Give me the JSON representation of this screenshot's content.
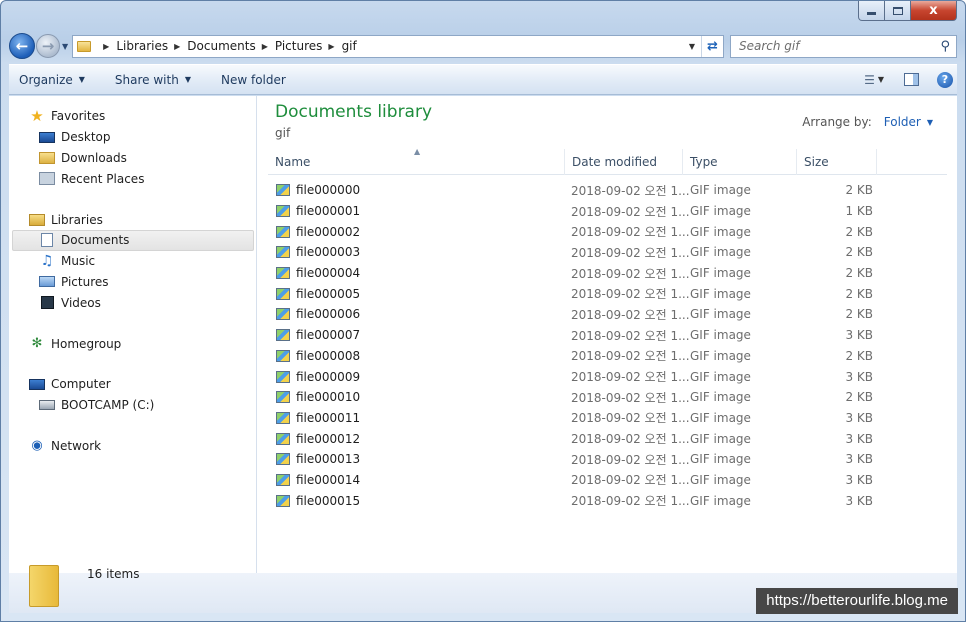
{
  "window": {
    "controls": {
      "close_label": "x"
    }
  },
  "address": {
    "crumbs": [
      "Libraries",
      "Documents",
      "Pictures",
      "gif"
    ]
  },
  "search": {
    "placeholder": "Search gif"
  },
  "toolbar": {
    "organize": "Organize",
    "share_with": "Share with",
    "new_folder": "New folder"
  },
  "sidebar": {
    "favorites": "Favorites",
    "desktop": "Desktop",
    "downloads": "Downloads",
    "recent_places": "Recent Places",
    "libraries": "Libraries",
    "documents": "Documents",
    "music": "Music",
    "pictures": "Pictures",
    "videos": "Videos",
    "homegroup": "Homegroup",
    "computer": "Computer",
    "bootcamp": "BOOTCAMP (C:)",
    "network": "Network"
  },
  "main": {
    "title": "Documents library",
    "subtitle": "gif",
    "arrange_label": "Arrange by:",
    "arrange_value": "Folder",
    "columns": {
      "name": "Name",
      "date": "Date modified",
      "type": "Type",
      "size": "Size"
    },
    "files": [
      {
        "name": "file000000",
        "date": "2018-09-02 오전 1...",
        "type": "GIF image",
        "size": "2 KB"
      },
      {
        "name": "file000001",
        "date": "2018-09-02 오전 1...",
        "type": "GIF image",
        "size": "1 KB"
      },
      {
        "name": "file000002",
        "date": "2018-09-02 오전 1...",
        "type": "GIF image",
        "size": "2 KB"
      },
      {
        "name": "file000003",
        "date": "2018-09-02 오전 1...",
        "type": "GIF image",
        "size": "2 KB"
      },
      {
        "name": "file000004",
        "date": "2018-09-02 오전 1...",
        "type": "GIF image",
        "size": "2 KB"
      },
      {
        "name": "file000005",
        "date": "2018-09-02 오전 1...",
        "type": "GIF image",
        "size": "2 KB"
      },
      {
        "name": "file000006",
        "date": "2018-09-02 오전 1...",
        "type": "GIF image",
        "size": "2 KB"
      },
      {
        "name": "file000007",
        "date": "2018-09-02 오전 1...",
        "type": "GIF image",
        "size": "3 KB"
      },
      {
        "name": "file000008",
        "date": "2018-09-02 오전 1...",
        "type": "GIF image",
        "size": "2 KB"
      },
      {
        "name": "file000009",
        "date": "2018-09-02 오전 1...",
        "type": "GIF image",
        "size": "3 KB"
      },
      {
        "name": "file000010",
        "date": "2018-09-02 오전 1...",
        "type": "GIF image",
        "size": "2 KB"
      },
      {
        "name": "file000011",
        "date": "2018-09-02 오전 1...",
        "type": "GIF image",
        "size": "3 KB"
      },
      {
        "name": "file000012",
        "date": "2018-09-02 오전 1...",
        "type": "GIF image",
        "size": "3 KB"
      },
      {
        "name": "file000013",
        "date": "2018-09-02 오전 1...",
        "type": "GIF image",
        "size": "3 KB"
      },
      {
        "name": "file000014",
        "date": "2018-09-02 오전 1...",
        "type": "GIF image",
        "size": "3 KB"
      },
      {
        "name": "file000015",
        "date": "2018-09-02 오전 1...",
        "type": "GIF image",
        "size": "3 KB"
      }
    ]
  },
  "status": {
    "item_count": "16 items"
  },
  "watermark": "https://betterourlife.blog.me",
  "colors": {
    "library_title": "#1e8d3c",
    "link_blue": "#1e5fb4",
    "close_red": "#c7452f"
  }
}
